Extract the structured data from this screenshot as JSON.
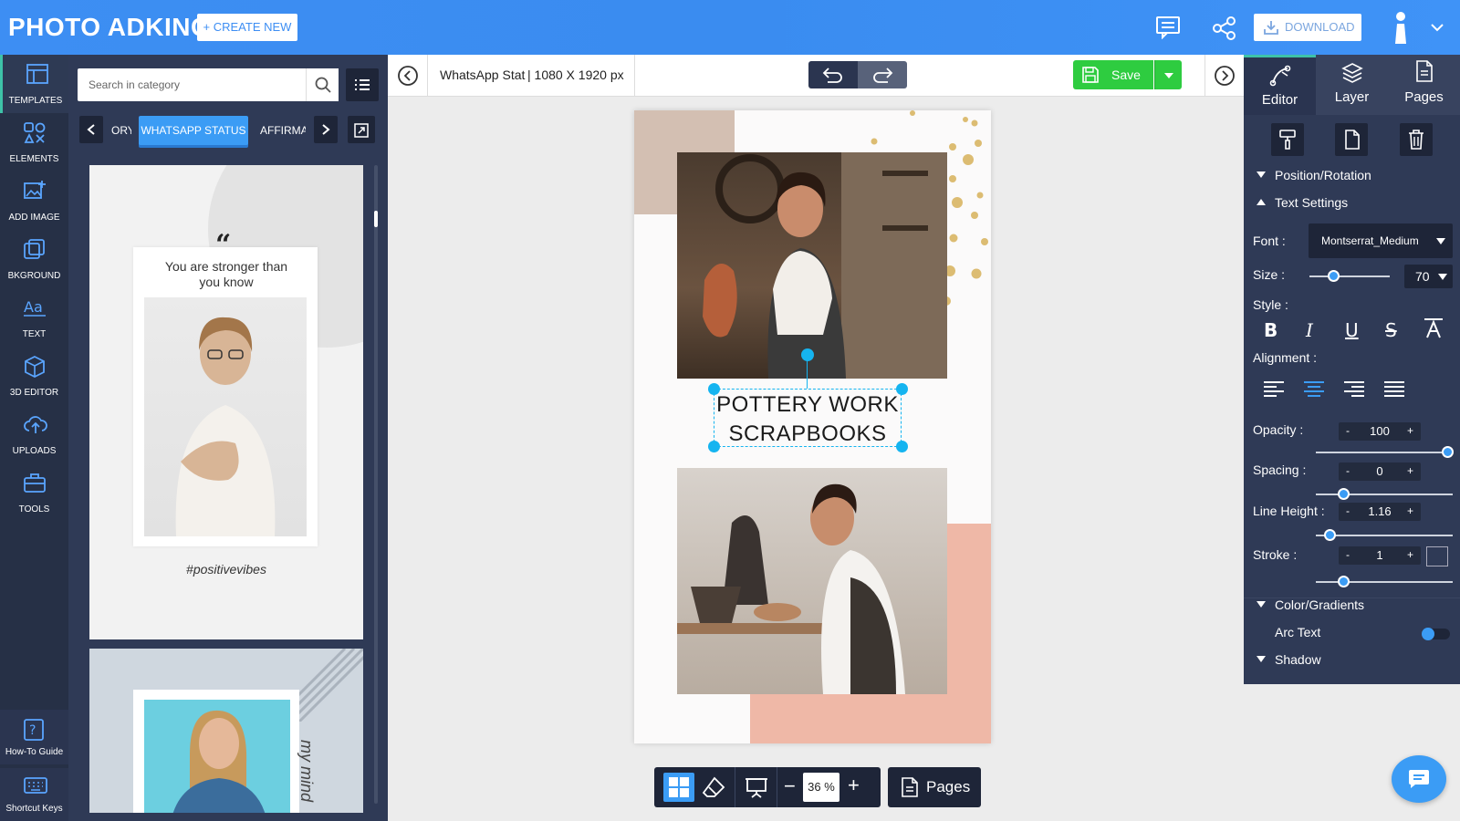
{
  "app": {
    "logo": "PHOTO ADKING",
    "create_new": "+ CREATE NEW",
    "download": "DOWNLOAD",
    "colors": {
      "topbar": "#3d8ef3",
      "nav": "#263046",
      "panel": "#2f3a56",
      "accent": "#3b9cf5",
      "save": "#2ecc40",
      "selection": "#15b4f0"
    }
  },
  "nav": {
    "items": [
      {
        "label": "TEMPLATES",
        "icon": "templates-icon"
      },
      {
        "label": "ELEMENTS",
        "icon": "elements-icon"
      },
      {
        "label": "ADD IMAGE",
        "icon": "add-image-icon"
      },
      {
        "label": "BKGROUND",
        "icon": "background-icon"
      },
      {
        "label": "TEXT",
        "icon": "text-icon"
      },
      {
        "label": "3D EDITOR",
        "icon": "cube-icon"
      },
      {
        "label": "UPLOADS",
        "icon": "upload-icon"
      },
      {
        "label": "TOOLS",
        "icon": "toolbox-icon"
      }
    ],
    "how_to": "How-To Guide",
    "shortcuts": "Shortcut Keys"
  },
  "catalog": {
    "search_placeholder": "Search in category",
    "chips": [
      "ORY",
      "WHATSAPP STATUS",
      "AFFIRMA"
    ],
    "template1": {
      "quote": "You are stronger than you know",
      "hashtag": "#positivevibes"
    },
    "template2": {
      "vertical_text": "my mind"
    }
  },
  "toolbar": {
    "doc_name": "WhatsApp Stat",
    "doc_size": "| 1080 X 1920 px",
    "save": "Save"
  },
  "canvas": {
    "text_line1": "POTTERY WORK",
    "text_line2": "SCRAPBOOKS",
    "zoom": "36 %",
    "pages": "Pages"
  },
  "right": {
    "tabs": [
      "Editor",
      "Layer",
      "Pages"
    ],
    "position_rotation": "Position/Rotation",
    "text_settings": "Text Settings",
    "font_label": "Font :",
    "font_value": "Montserrat_Medium",
    "size_label": "Size :",
    "size_value": "70",
    "size_level": 0.3,
    "style_label": "Style :",
    "alignment_label": "Alignment :",
    "opacity_label": "Opacity :",
    "opacity_value": "100",
    "opacity_level": 1.0,
    "spacing_label": "Spacing :",
    "spacing_value": "0",
    "spacing_level": 0.2,
    "line_height_label": "Line Height :",
    "line_height_value": "1.16",
    "line_height_level": 0.1,
    "stroke_label": "Stroke :",
    "stroke_value": "1",
    "stroke_level": 0.2,
    "color_gradients": "Color/Gradients",
    "arc_text": "Arc Text",
    "shadow": "Shadow"
  }
}
